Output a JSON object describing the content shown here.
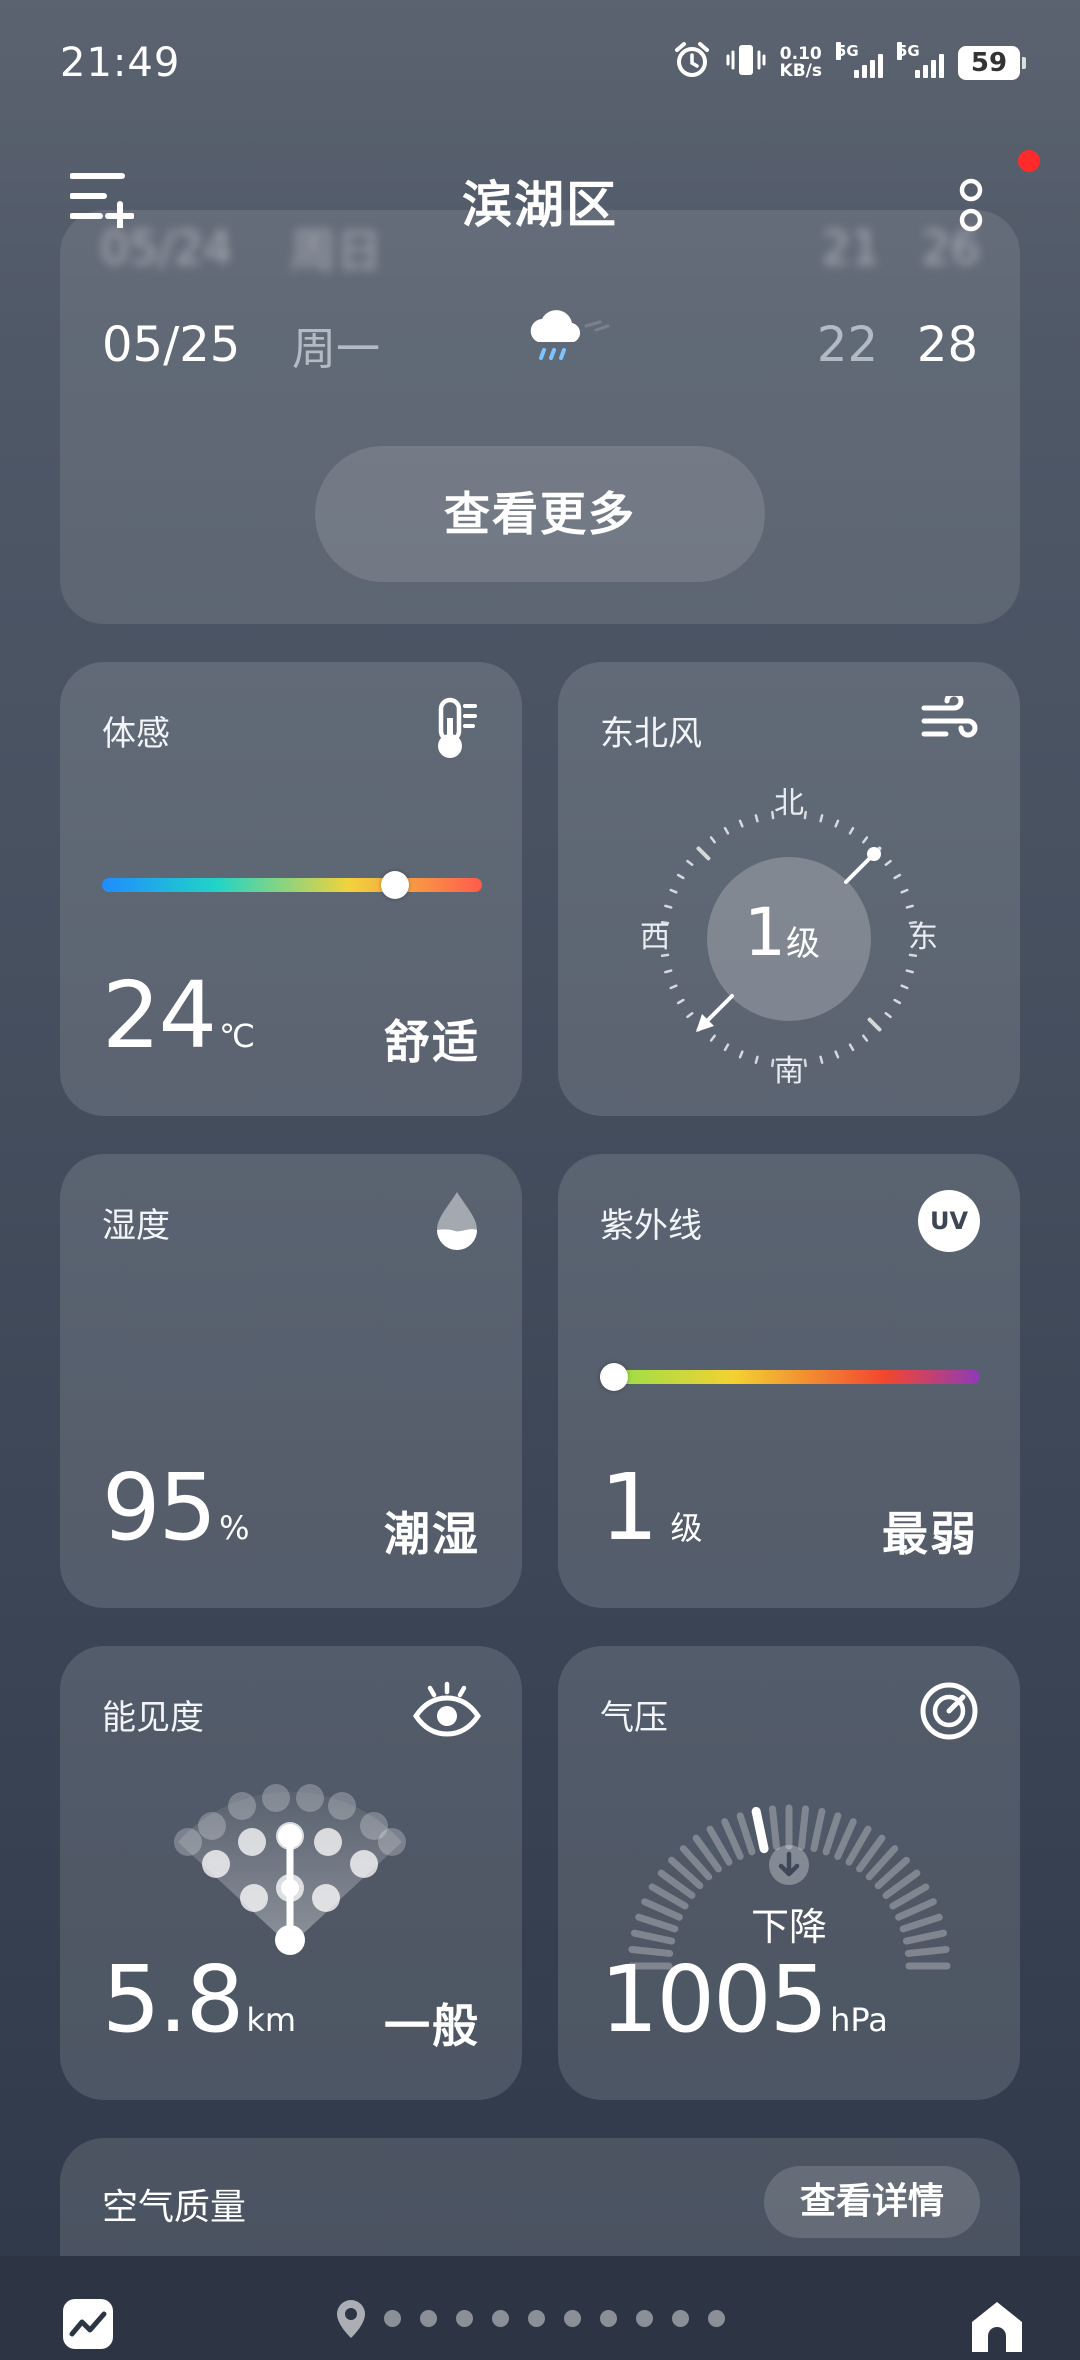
{
  "status_bar": {
    "time": "21:49",
    "net_speed": "0.10",
    "net_unit": "KB/s",
    "sim1": "5G",
    "sim2": "5G",
    "battery": "59"
  },
  "header": {
    "city": "滨湖区"
  },
  "forecast": {
    "prev_row": {
      "date": "05/24",
      "weekday": "周日",
      "low": "21",
      "high": "26"
    },
    "row": {
      "date": "05/25",
      "weekday": "周一",
      "low": "22",
      "high": "28",
      "icon": "rain-cloud-icon"
    },
    "more_label": "查看更多"
  },
  "feels_like": {
    "title": "体感",
    "value": "24",
    "unit": "℃",
    "status": "舒适",
    "level": 0.77
  },
  "wind": {
    "title": "东北风",
    "level_value": "1",
    "level_unit": "级",
    "north": "北",
    "south": "南",
    "east": "东",
    "west": "西"
  },
  "humidity": {
    "title": "湿度",
    "value": "95",
    "unit": "%",
    "status": "潮湿"
  },
  "uv": {
    "title": "紫外线",
    "icon_text": "UV",
    "value": "1",
    "unit": "级",
    "status": "最弱",
    "level": 0.0
  },
  "visibility": {
    "title": "能见度",
    "value": "5.8",
    "unit": "km",
    "status": "一般"
  },
  "pressure": {
    "title": "气压",
    "trend": "下降",
    "value": "1005",
    "unit": "hPa"
  },
  "air_quality": {
    "title": "空气质量",
    "detail_label": "查看详情"
  }
}
